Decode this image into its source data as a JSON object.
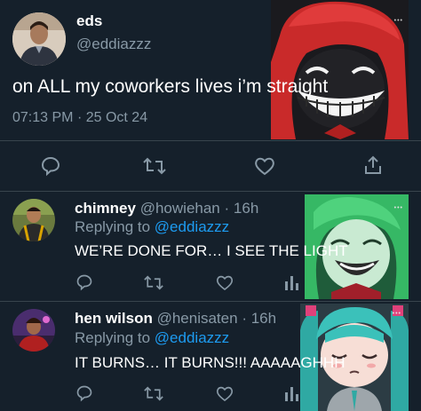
{
  "main_tweet": {
    "display_name": "eds",
    "handle": "@eddiazzz",
    "text": "on ALL my coworkers lives i’m straight",
    "time": "07:13 PM",
    "separator": "·",
    "date": "25 Oct 24"
  },
  "replies": [
    {
      "display_name": "chimney",
      "handle": "@howiehan",
      "separator": "·",
      "time": "16h",
      "replying_prefix": "Replying to",
      "replying_handle": "@eddiazzz",
      "text": "WE’RE DONE FOR… I SEE THE LIGHT"
    },
    {
      "display_name": "hen wilson",
      "handle": "@henisaten",
      "separator": "·",
      "time": "16h",
      "replying_prefix": "Replying to",
      "replying_handle": "@eddiazzz",
      "text": "IT BURNS… IT BURNS!!! AAAAAGHHH"
    }
  ],
  "overlay_dots": "•••",
  "colors": {
    "background": "#15202b",
    "muted": "#8899a6",
    "link": "#1d9bf0",
    "divider": "#38444d"
  },
  "icons": [
    "reply-icon",
    "retweet-icon",
    "like-icon",
    "share-icon",
    "analytics-icon"
  ]
}
